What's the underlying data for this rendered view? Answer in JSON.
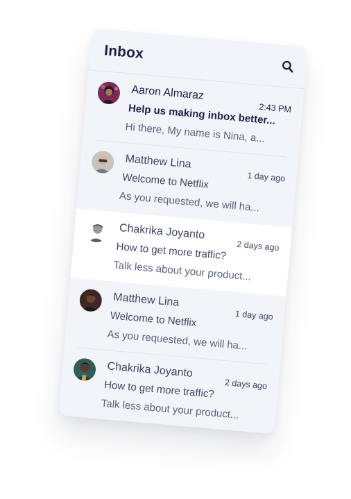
{
  "inbox": {
    "title": "Inbox",
    "messages": [
      {
        "sender": "Aaron Almaraz",
        "time": "2:43 PM",
        "subject": "Help us making inbox better...",
        "preview": "Hi there, My name is Nina, a...",
        "unread": true,
        "selected": false,
        "avatar_color": "#7b2a57"
      },
      {
        "sender": "Matthew Lina",
        "time": "1 day ago",
        "subject": "Welcome to Netflix",
        "preview": "As you requested, we will ha...",
        "unread": false,
        "selected": false,
        "avatar_color": "#c9c3bb"
      },
      {
        "sender": "Chakrika Joyanto",
        "time": "2 days ago",
        "subject": "How to get more traffic?",
        "preview": "Talk less about your product...",
        "unread": false,
        "selected": true,
        "avatar_color": "#d7d7d7"
      },
      {
        "sender": "Matthew Lina",
        "time": "1 day ago",
        "subject": "Welcome to Netflix",
        "preview": "As you requested, we will ha...",
        "unread": false,
        "selected": false,
        "avatar_color": "#3a2a22"
      },
      {
        "sender": "Chakrika Joyanto",
        "time": "2 days ago",
        "subject": "How to get more traffic?",
        "preview": "Talk less about your product...",
        "unread": false,
        "selected": false,
        "avatar_color": "#2f5d58"
      }
    ]
  },
  "icons": {
    "search": "search-icon"
  },
  "colors": {
    "card_background": "#f1f4f9",
    "selected_background": "#ffffff",
    "title_text": "#1a2145",
    "body_text": "#3d4660"
  }
}
